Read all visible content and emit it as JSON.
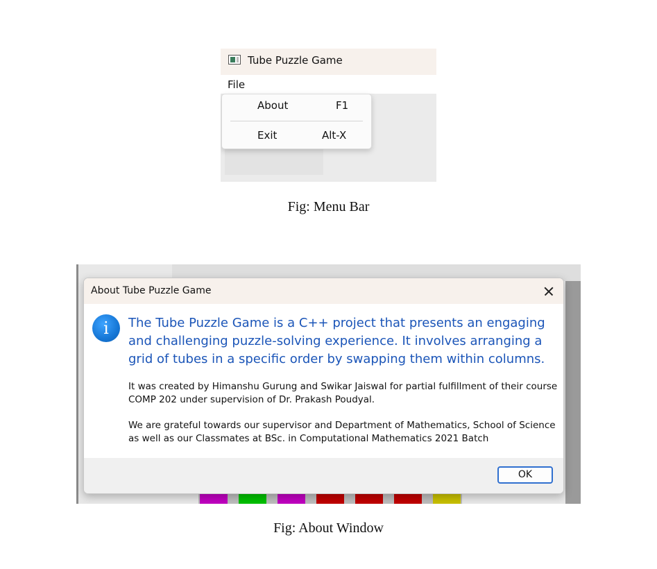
{
  "figure1": {
    "window_title": "Tube Puzzle Game",
    "menu": {
      "file_label": "File"
    },
    "dropdown": [
      {
        "label": "About",
        "shortcut": "F1"
      },
      {
        "label": "Exit",
        "shortcut": "Alt-X"
      }
    ],
    "caption": "Fig: Menu Bar"
  },
  "figure2": {
    "dialog_title": "About Tube Puzzle Game",
    "icon": "info-icon",
    "main_message": "The Tube Puzzle Game is a C++ project that presents an engaging and challenging puzzle-solving experience. It involves arranging a grid of tubes in a specific order by swapping them within columns.",
    "detail_1": " It was created by Himanshu Gurung and Swikar Jaiswal for partial fulfillment of their course COMP 202 under supervision of Dr. Prakash Poudyal.",
    "detail_2": " We are grateful towards our supervisor and Department of Mathematics, School of Science as well as our Classmates at BSc. in Computational Mathematics 2021 Batch",
    "ok_label": "OK",
    "background_tube_colors": [
      "#c000c0",
      "#00c000",
      "#c000c0",
      "#c00000",
      "#c00000",
      "#c00000",
      "#c8c000"
    ],
    "caption": "Fig: About Window"
  }
}
